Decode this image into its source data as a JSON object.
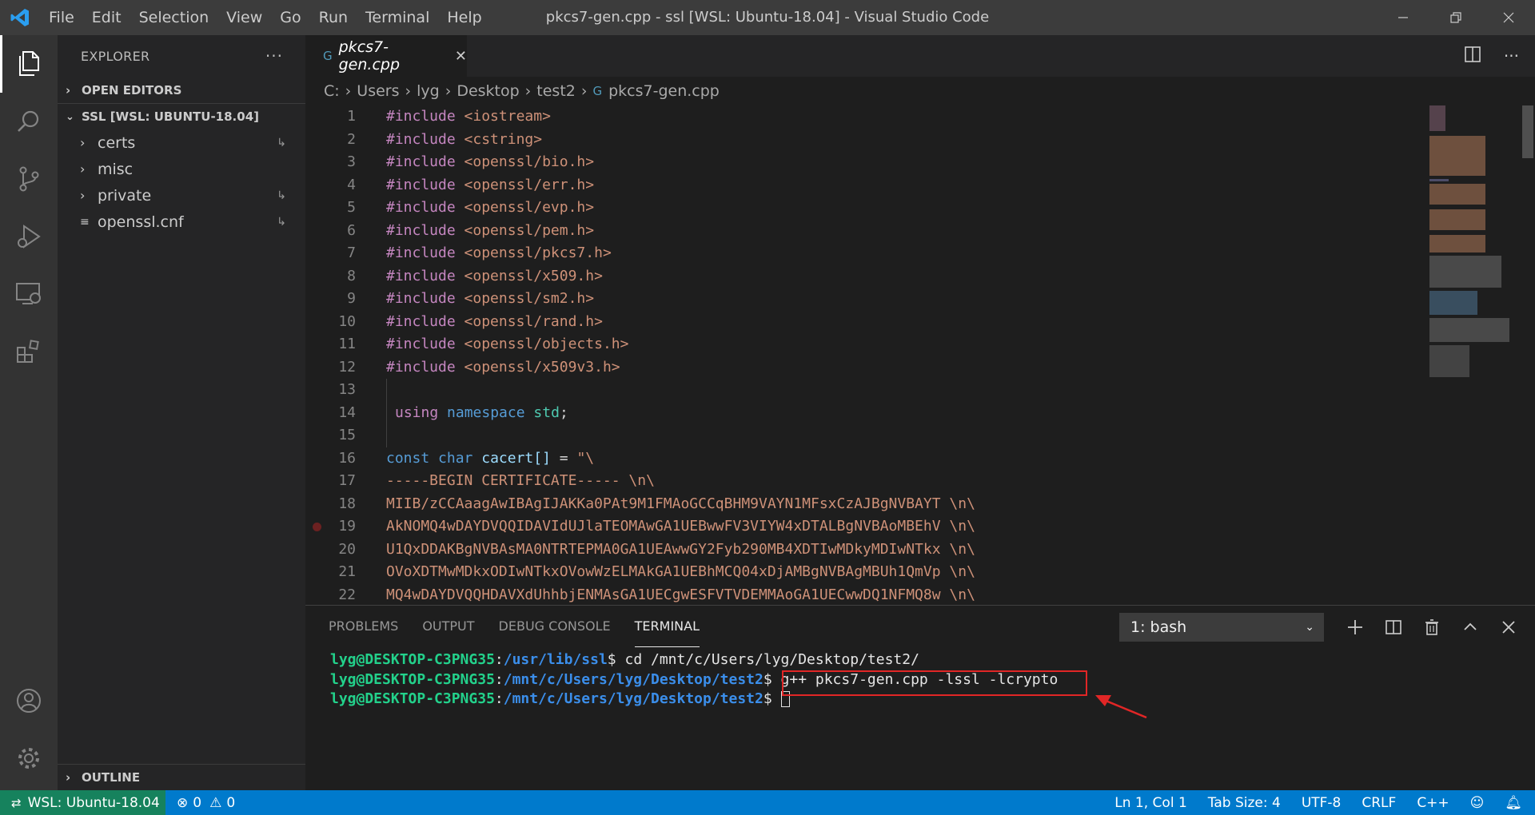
{
  "titlebar": {
    "menu": [
      "File",
      "Edit",
      "Selection",
      "View",
      "Go",
      "Run",
      "Terminal",
      "Help"
    ],
    "title": "pkcs7-gen.cpp - ssl [WSL: Ubuntu-18.04] - Visual Studio Code"
  },
  "sidebar": {
    "header": "EXPLORER",
    "open_editors": "OPEN EDITORS",
    "workspace": "SSL [WSL: UBUNTU-18.04]",
    "items": [
      {
        "label": "certs",
        "type": "folder"
      },
      {
        "label": "misc",
        "type": "folder"
      },
      {
        "label": "private",
        "type": "folder"
      },
      {
        "label": "openssl.cnf",
        "type": "file"
      }
    ],
    "outline": "OUTLINE"
  },
  "tab": {
    "label": "pkcs7-gen.cpp",
    "icon": "cpp-icon"
  },
  "breadcrumb": [
    "C:",
    "Users",
    "lyg",
    "Desktop",
    "test2",
    "pkcs7-gen.cpp"
  ],
  "code": {
    "line_numbers": [
      "1",
      "2",
      "3",
      "4",
      "5",
      "6",
      "7",
      "8",
      "9",
      "10",
      "11",
      "12",
      "13",
      "14",
      "15",
      "16",
      "17",
      "18",
      "19",
      "20",
      "21",
      "22"
    ],
    "includes": [
      "<iostream>",
      "<cstring>",
      "<openssl/bio.h>",
      "<openssl/err.h>",
      "<openssl/evp.h>",
      "<openssl/pem.h>",
      "<openssl/pkcs7.h>",
      "<openssl/x509.h>",
      "<openssl/sm2.h>",
      "<openssl/rand.h>",
      "<openssl/objects.h>",
      "<openssl/x509v3.h>"
    ],
    "include_kw": "#include",
    "line14": {
      "using": "using",
      "namespace": "namespace",
      "std": "std",
      "semi": ";"
    },
    "line16": {
      "const": "const",
      "char": "char",
      "name": "cacert[]",
      "eq": " = ",
      "str": "\"\\"
    },
    "cert_lines": [
      "-----BEGIN CERTIFICATE----- \\n\\",
      "MIIB/zCCAaagAwIBAgIJAKKa0PAt9M1FMAoGCCqBHM9VAYN1MFsxCzAJBgNVBAYT \\n\\",
      "AkNOMQ4wDAYDVQQIDAVIdUJlaTEOMAwGA1UEBwwFV3VIYW4xDTALBgNVBAoMBEhV \\n\\",
      "U1QxDDAKBgNVBAsMA0NTRTEPMA0GA1UEAwwGY2Fyb290MB4XDTIwMDkyMDIwNTkx \\n\\",
      "OVoXDTMwMDkxODIwNTkxOVowWzELMAkGA1UEBhMCQ04xDjAMBgNVBAgMBUh1QmVp \\n\\",
      "MQ4wDAYDVQQHDAVXdUhhbjENMAsGA1UECgwESFVTVDEMMAoGA1UECwwDQ1NFMQ8w \\n\\"
    ]
  },
  "panel": {
    "tabs": [
      "PROBLEMS",
      "OUTPUT",
      "DEBUG CONSOLE",
      "TERMINAL"
    ],
    "active_tab": "TERMINAL",
    "terminal_select": "1: bash",
    "terminal": [
      {
        "user": "lyg@DESKTOP-C3PNG35",
        "path": "/usr/lib/ssl",
        "cmd": " cd /mnt/c/Users/lyg/Desktop/test2/"
      },
      {
        "user": "lyg@DESKTOP-C3PNG35",
        "path": "/mnt/c/Users/lyg/Desktop/test2",
        "cmd": " g++ pkcs7-gen.cpp -lssl -lcrypto"
      },
      {
        "user": "lyg@DESKTOP-C3PNG35",
        "path": "/mnt/c/Users/lyg/Desktop/test2",
        "cmd": " "
      }
    ]
  },
  "statusbar": {
    "remote": "WSL: Ubuntu-18.04",
    "errors": "0",
    "warnings": "0",
    "position": "Ln 1, Col 1",
    "tab_size": "Tab Size: 4",
    "encoding": "UTF-8",
    "eol": "CRLF",
    "language": "C++"
  },
  "colors": {
    "accent": "#007acc",
    "remote": "#16825d",
    "annotation": "#e12626"
  }
}
